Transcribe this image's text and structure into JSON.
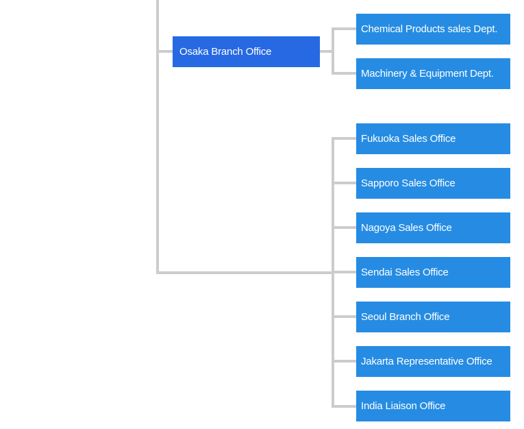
{
  "colors": {
    "branch": "#2769e2",
    "department": "#268ce3",
    "connector": "#cccccc"
  },
  "branch": {
    "label": "Osaka Branch Office"
  },
  "branch_departments": [
    {
      "label": "Chemical Products sales Dept."
    },
    {
      "label": "Machinery & Equipment Dept."
    }
  ],
  "offices": [
    {
      "label": "Fukuoka Sales Office"
    },
    {
      "label": "Sapporo Sales Office"
    },
    {
      "label": "Nagoya Sales Office"
    },
    {
      "label": "Sendai Sales Office"
    },
    {
      "label": "Seoul Branch Office"
    },
    {
      "label": "Jakarta Representative Office"
    },
    {
      "label": "India Liaison Office"
    }
  ]
}
